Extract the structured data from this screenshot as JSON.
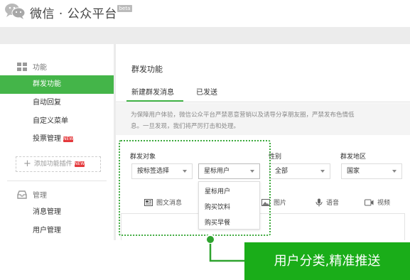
{
  "header": {
    "brand": "微信 · 公众平台",
    "beta": "beta"
  },
  "sidebar": {
    "groups": [
      {
        "label": "功能",
        "icon": "grid-icon"
      },
      {
        "label": "管理",
        "icon": "inbox-icon"
      }
    ],
    "items": [
      {
        "label": "群发功能",
        "active": true
      },
      {
        "label": "自动回复"
      },
      {
        "label": "自定义菜单"
      },
      {
        "label": "投票管理",
        "badge": "NEW"
      },
      {
        "label": "消息管理"
      },
      {
        "label": "用户管理"
      }
    ],
    "add_plugin": {
      "label": "添加功能插件",
      "badge": "NEW"
    }
  },
  "main": {
    "title": "群发功能",
    "tabs": [
      {
        "label": "新建群发消息",
        "active": true
      },
      {
        "label": "已发送"
      }
    ],
    "notice": [
      "为保障用户体验，微信公众平台严禁恶意营销以及诱导分享朋友圈，严禁发布色情低",
      "息。一旦发现，我们将严厉打击和处理。"
    ],
    "filters": {
      "target": {
        "label": "群发对象",
        "value": "按标签选择",
        "sub_value": "星标用户"
      },
      "gender": {
        "label": "性别",
        "value": "全部"
      },
      "region": {
        "label": "群发地区",
        "value": "国家"
      }
    },
    "dropdown_options": [
      "星标用户",
      "购买饮料",
      "购买早餐"
    ],
    "message_types": [
      {
        "label": "图文消息",
        "icon": "news-icon"
      },
      {
        "label": "图片",
        "icon": "image-icon"
      },
      {
        "label": "语音",
        "icon": "microphone-icon"
      },
      {
        "label": "视频",
        "icon": "video-icon"
      }
    ]
  },
  "callout": {
    "text": "用户分类,精准推送"
  },
  "colors": {
    "accent": "#44b549",
    "callout": "#1aad19",
    "highlight": "#3daa3d",
    "badge": "#e4393c"
  }
}
